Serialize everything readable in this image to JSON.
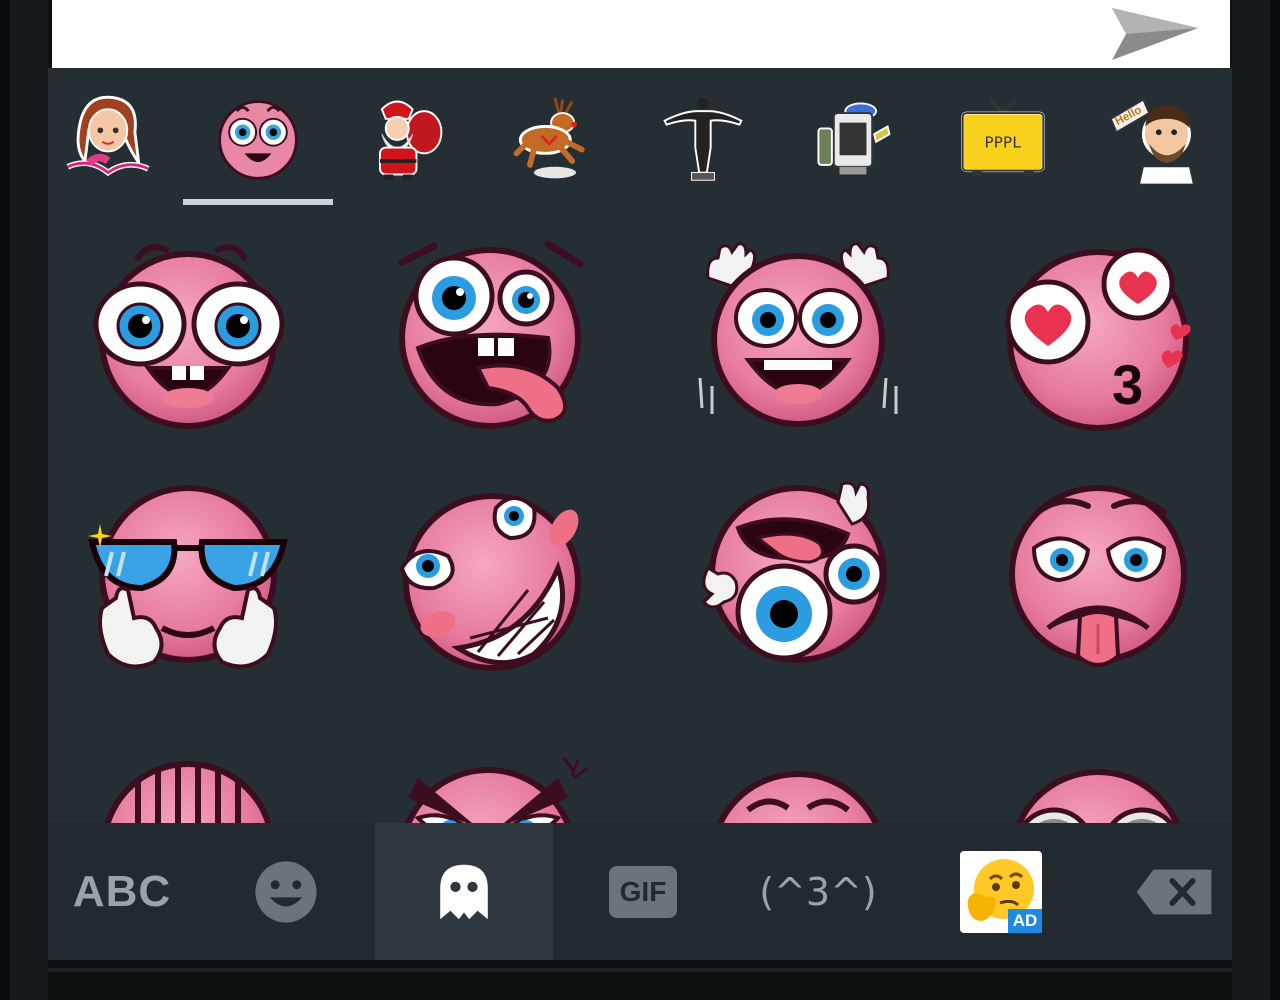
{
  "input": {
    "placeholder": ""
  },
  "colors": {
    "keyboard_bg": "#252e33",
    "bottom_bar_bg": "#222a2f",
    "icon_gray": "#9aa3a8",
    "sticker_pink": "#e87aa0",
    "ad_blue": "#1e88e5"
  },
  "pack_tabs": [
    {
      "name": "girl-sticker-pack",
      "selected": false
    },
    {
      "name": "pink-emoji-pack",
      "selected": true
    },
    {
      "name": "santa-pack",
      "selected": false
    },
    {
      "name": "reindeer-pack",
      "selected": false
    },
    {
      "name": "statue-pack",
      "selected": false
    },
    {
      "name": "robot-pack",
      "selected": false
    },
    {
      "name": "tv-pack",
      "selected": false
    },
    {
      "name": "hello-man-pack",
      "selected": false
    }
  ],
  "pack_text": {
    "tv": "PPPL",
    "hello": "Hello"
  },
  "stickers": [
    "surprised-face",
    "tongue-out-face",
    "hands-up-face",
    "heart-eyes-kiss-face",
    "sunglasses-face",
    "grinning-wink-face",
    "crazy-face",
    "pleading-tongue-face",
    "face-partial-1",
    "angry-face-partial",
    "blush-face-partial",
    "spiral-eyes-partial"
  ],
  "bottom_bar": {
    "abc_label": "ABC",
    "gif_label": "GIF",
    "kaomoji_label": "(^3^)",
    "ad_label": "AD",
    "selected": "sticker"
  },
  "kiss_text": "3"
}
